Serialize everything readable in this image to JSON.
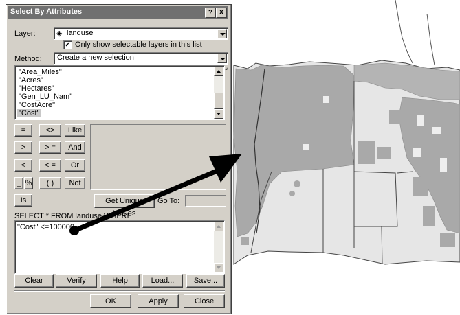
{
  "dialog": {
    "title": "Select By Attributes",
    "help_btn": "?",
    "close_btn": "X",
    "layer_label": "Layer:",
    "layer_value": "landuse",
    "only_selectable": "Only show selectable layers in this list",
    "only_selectable_checked": true,
    "method_label": "Method:",
    "method_value": "Create a new selection",
    "fields": [
      "\"Area_Miles\"",
      "\"Acres\"",
      "\"Hectares\"",
      "\"Gen_LU_Nam\"",
      "\"CostAcre\"",
      "\"Cost\""
    ],
    "selected_field_index": 5,
    "operators": {
      "eq": "=",
      "ne": "<>",
      "like": "Like",
      "gt": ">",
      "ge": "> =",
      "and": "And",
      "lt": "<",
      "le": "< =",
      "or": "Or",
      "underscore": "_",
      "percent": "%",
      "parens": "( )",
      "not": "Not",
      "is": "Is"
    },
    "get_unique": "Get Unique Values",
    "goto_label": "Go To:",
    "goto_value": "",
    "sql_label": "SELECT * FROM landuse WHERE:",
    "sql_text": "\"Cost\" <=100000",
    "buttons": {
      "clear": "Clear",
      "verify": "Verify",
      "help": "Help",
      "load": "Load...",
      "save": "Save...",
      "ok": "OK",
      "apply": "Apply",
      "close": "Close"
    }
  },
  "map": {
    "fill_color": "#a9a9a9",
    "base_color": "#e8e8e8",
    "line_color": "#555555"
  }
}
